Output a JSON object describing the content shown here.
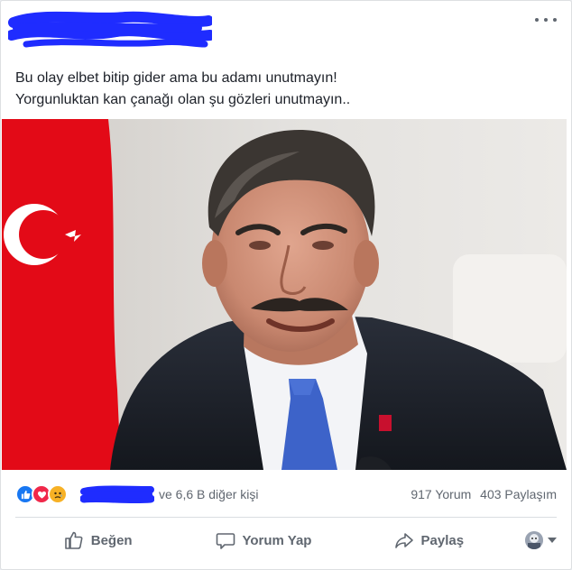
{
  "post": {
    "author_redacted": true,
    "text_lines": [
      "Bu olay elbet bitip gider ama bu adamı unutmayın!",
      "Yorgunluktan kan çanağı olan şu gözleri unutmayın.."
    ]
  },
  "reactions": {
    "icons": [
      "like-icon",
      "love-icon",
      "sad-icon"
    ],
    "summary": "ve 6,6 B diğer kişi",
    "comments": "917 Yorum",
    "shares": "403 Paylaşım"
  },
  "actions": {
    "like_label": "Beğen",
    "comment_label": "Yorum Yap",
    "share_label": "Paylaş"
  },
  "colors": {
    "scribble": "#1f2cff",
    "like": "#1877f2",
    "love": "#f0284a",
    "sad": "#f7b125",
    "flag": "#e30a17"
  }
}
